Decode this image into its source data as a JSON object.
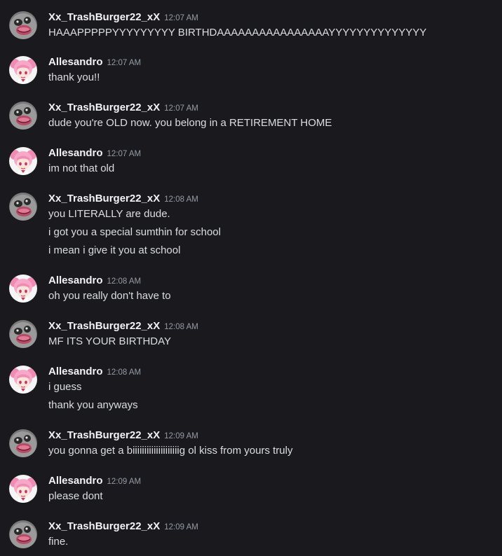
{
  "colors": {
    "background": "#1a1a1e",
    "username": "#f2f3f5",
    "timestamp": "#949ba4",
    "message_text": "#dbdee1"
  },
  "users": {
    "trash": {
      "name": "Xx_TrashBurger22_xX",
      "avatar_icon": "skull-cat-avatar-icon"
    },
    "alle": {
      "name": "Allesandro",
      "avatar_icon": "pink-anime-girl-avatar-icon"
    }
  },
  "messages": [
    {
      "author": "trash",
      "username": "Xx_TrashBurger22_xX",
      "time": "12:07 AM",
      "lines": [
        "HAAAPPPPPYYYYYYYYY BIRTHDAAAAAAAAAAAAAAAAYYYYYYYYYYYYYY"
      ]
    },
    {
      "author": "alle",
      "username": "Allesandro",
      "time": "12:07 AM",
      "lines": [
        "thank you!!"
      ]
    },
    {
      "author": "trash",
      "username": "Xx_TrashBurger22_xX",
      "time": "12:07 AM",
      "lines": [
        "dude you're OLD now. you belong in a RETIREMENT HOME"
      ]
    },
    {
      "author": "alle",
      "username": "Allesandro",
      "time": "12:07 AM",
      "lines": [
        "im not that old"
      ]
    },
    {
      "author": "trash",
      "username": "Xx_TrashBurger22_xX",
      "time": "12:08 AM",
      "lines": [
        "you LITERALLY are dude.",
        "i got you a special sumthin for school",
        "i mean i give it you at school"
      ]
    },
    {
      "author": "alle",
      "username": "Allesandro",
      "time": "12:08 AM",
      "lines": [
        "oh you really don't have to"
      ]
    },
    {
      "author": "trash",
      "username": "Xx_TrashBurger22_xX",
      "time": "12:08 AM",
      "lines": [
        "MF ITS YOUR BIRTHDAY"
      ]
    },
    {
      "author": "alle",
      "username": "Allesandro",
      "time": "12:08 AM",
      "lines": [
        "i guess",
        "thank you anyways"
      ]
    },
    {
      "author": "trash",
      "username": "Xx_TrashBurger22_xX",
      "time": "12:09 AM",
      "lines": [
        "you gonna get a biiiiiiiiiiiiiiiiiiiig ol kiss from yours truly"
      ]
    },
    {
      "author": "alle",
      "username": "Allesandro",
      "time": "12:09 AM",
      "lines": [
        "please dont"
      ]
    },
    {
      "author": "trash",
      "username": "Xx_TrashBurger22_xX",
      "time": "12:09 AM",
      "lines": [
        "fine."
      ]
    }
  ]
}
